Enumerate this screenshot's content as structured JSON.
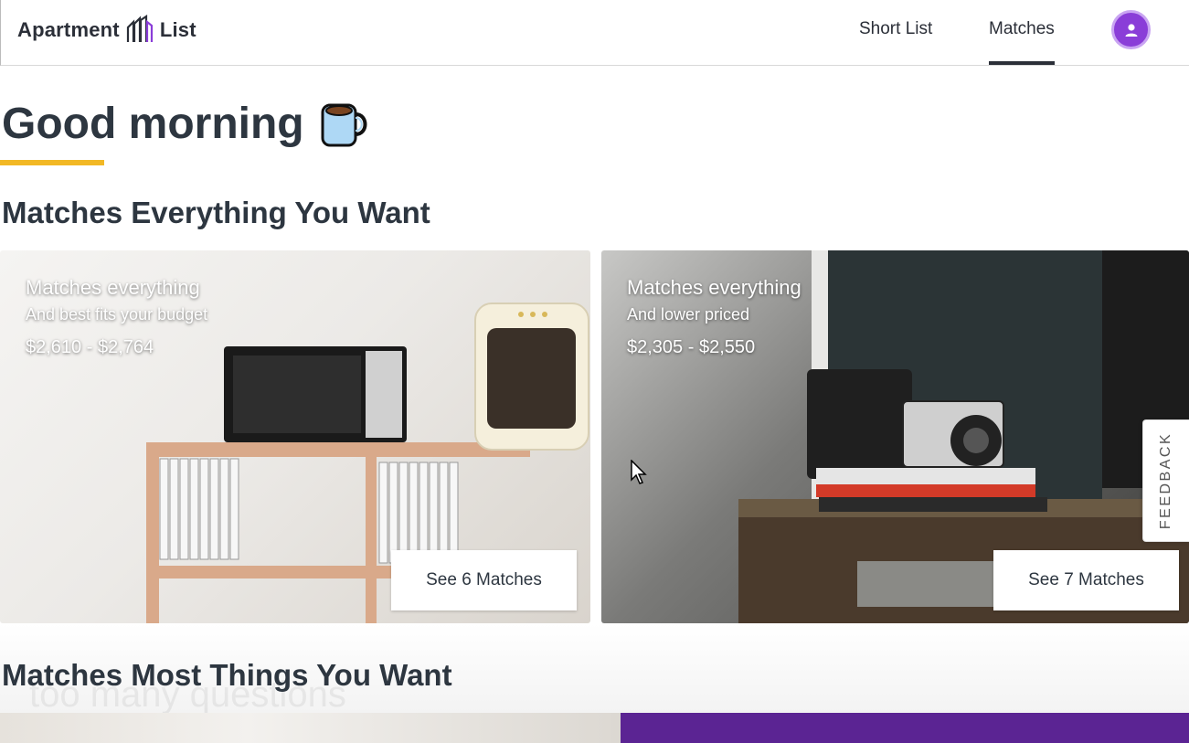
{
  "header": {
    "logo_left": "Apartment",
    "logo_right": "List",
    "nav": {
      "short_list": "Short List",
      "matches": "Matches"
    }
  },
  "greeting": {
    "text": "Good morning",
    "icon": "coffee-mug-icon",
    "underline_color": "#f2b825"
  },
  "sections": {
    "everything": "Matches Everything You Want",
    "most": "Matches Most Things You Want"
  },
  "cards": [
    {
      "title": "Matches everything",
      "subtitle": "And best fits your budget",
      "price": "$2,610 - $2,764",
      "button": "See 6 Matches"
    },
    {
      "title": "Matches everything",
      "subtitle": "And lower priced",
      "price": "$2,305 - $2,550",
      "button": "See 7 Matches"
    }
  ],
  "feedback": "FEEDBACK",
  "ghost_text": "too many questions",
  "colors": {
    "accent_purple": "#8a3dd8",
    "banner_purple": "#5b2493",
    "text_dark": "#2d3640"
  }
}
